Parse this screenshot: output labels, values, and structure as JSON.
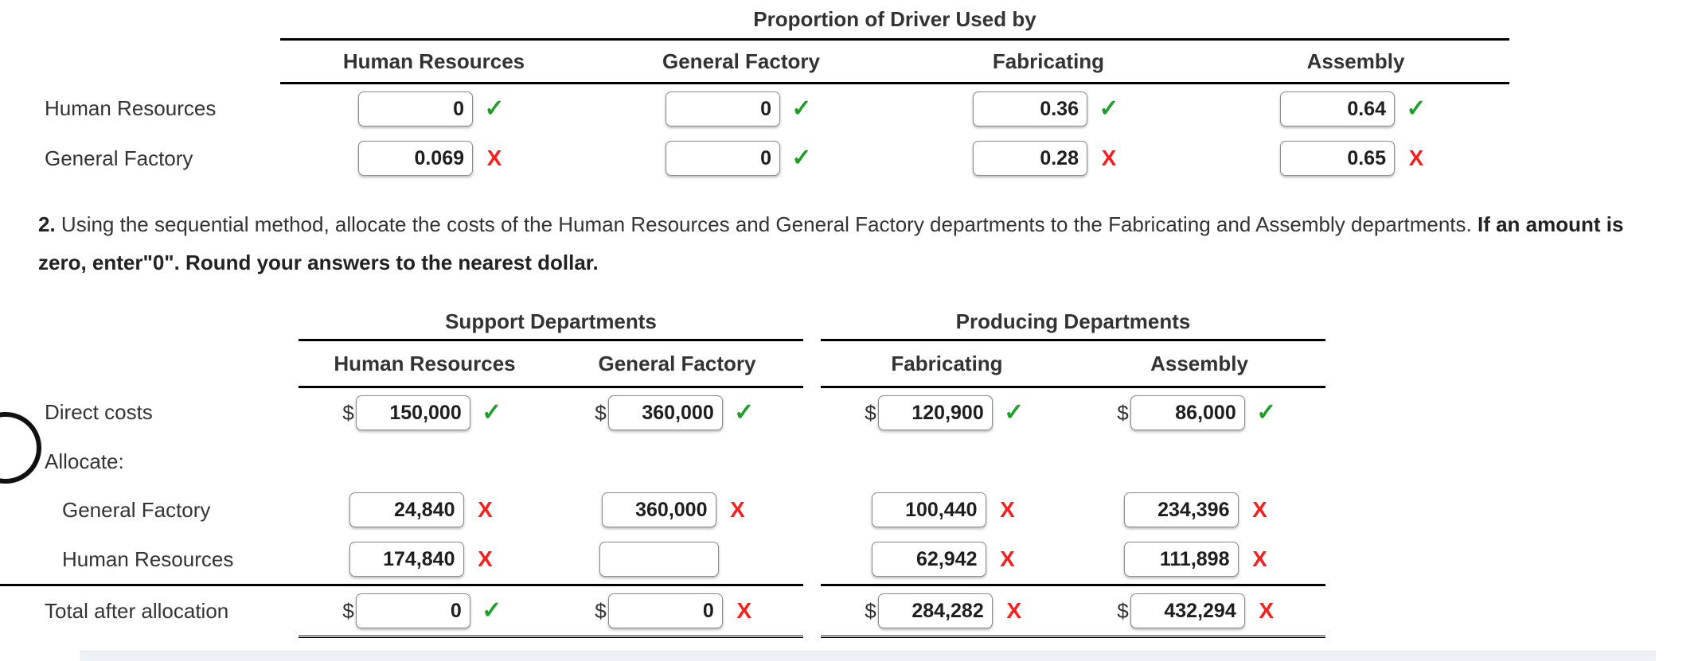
{
  "top_table": {
    "group_title": "Proportion of Driver Used by",
    "row_label_header": "",
    "columns": [
      "Human Resources",
      "General Factory",
      "Fabricating",
      "Assembly"
    ],
    "rows": [
      {
        "label": "Human Resources",
        "cells": [
          {
            "value": "0",
            "mark": "correct"
          },
          {
            "value": "0",
            "mark": "correct"
          },
          {
            "value": "0.36",
            "mark": "correct"
          },
          {
            "value": "0.64",
            "mark": "correct"
          }
        ]
      },
      {
        "label": "General Factory",
        "cells": [
          {
            "value": "0.069",
            "mark": "incorrect"
          },
          {
            "value": "0",
            "mark": "correct"
          },
          {
            "value": "0.28",
            "mark": "incorrect"
          },
          {
            "value": "0.65",
            "mark": "incorrect"
          }
        ]
      }
    ]
  },
  "instructions": {
    "number": "2.",
    "text_normal_1": " Using the sequential method, allocate the costs of the Human Resources and General Factory departments to the Fabricating and Assembly departments. ",
    "text_bold_1": "If an amount is zero, enter\"0\". Round your answers to the nearest dollar."
  },
  "bottom_table": {
    "groups": [
      "Support Departments",
      "Producing Departments"
    ],
    "columns": [
      "Human Resources",
      "General Factory",
      "Fabricating",
      "Assembly"
    ],
    "rows": [
      {
        "label": "Direct costs",
        "indent": false,
        "cells": [
          {
            "prefix": "$",
            "value": "150,000",
            "mark": "correct"
          },
          {
            "prefix": "$",
            "value": "360,000",
            "mark": "correct"
          },
          {
            "prefix": "$",
            "value": "120,900",
            "mark": "correct"
          },
          {
            "prefix": "$",
            "value": "86,000",
            "mark": "correct"
          }
        ]
      },
      {
        "label": "Allocate:",
        "indent": false,
        "cells": []
      },
      {
        "label": "General Factory",
        "indent": true,
        "cells": [
          {
            "prefix": "",
            "value": "24,840",
            "mark": "incorrect"
          },
          {
            "prefix": "",
            "value": "360,000",
            "mark": "incorrect"
          },
          {
            "prefix": "",
            "value": "100,440",
            "mark": "incorrect"
          },
          {
            "prefix": "",
            "value": "234,396",
            "mark": "incorrect"
          }
        ]
      },
      {
        "label": "Human Resources",
        "indent": true,
        "cells": [
          {
            "prefix": "",
            "value": "174,840",
            "mark": "incorrect"
          },
          {
            "prefix": "",
            "value": "",
            "mark": "none"
          },
          {
            "prefix": "",
            "value": "62,942",
            "mark": "incorrect"
          },
          {
            "prefix": "",
            "value": "111,898",
            "mark": "incorrect"
          }
        ]
      },
      {
        "label": "Total after allocation",
        "indent": false,
        "cells": [
          {
            "prefix": "$",
            "value": "0",
            "mark": "correct"
          },
          {
            "prefix": "$",
            "value": "0",
            "mark": "incorrect"
          },
          {
            "prefix": "$",
            "value": "284,282",
            "mark": "incorrect"
          },
          {
            "prefix": "$",
            "value": "432,294",
            "mark": "incorrect"
          }
        ]
      }
    ]
  },
  "marks": {
    "correct_glyph": "✓",
    "incorrect_glyph": "X",
    "correct_color": "#1f9d28",
    "incorrect_color": "#f5201e"
  }
}
